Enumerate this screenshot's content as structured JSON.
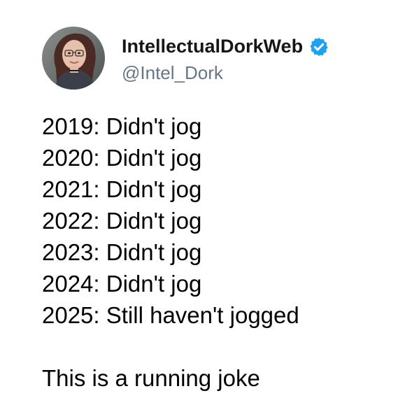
{
  "tweet": {
    "author": {
      "display_name": "IntellectualDorkWeb",
      "handle": "@Intel_Dork",
      "verified": true,
      "verified_icon": "verified-badge-icon",
      "verified_color": "#1da1f2"
    },
    "lines": [
      "2019:  Didn't jog",
      "2020: Didn't jog",
      "2021:  Didn't jog",
      "2022: Didn't jog",
      "2023: Didn't jog",
      "2024: Didn't jog",
      "2025: Still haven't jogged"
    ],
    "punchline": "This is a running joke"
  }
}
